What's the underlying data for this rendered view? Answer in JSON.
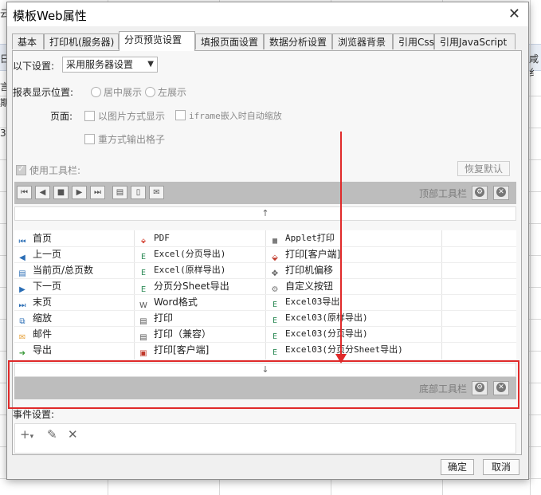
{
  "background": {
    "fragments": [
      "云",
      "日",
      "言",
      "期",
      "34",
      "咸纟"
    ]
  },
  "dialog": {
    "title": "模板Web属性",
    "close_glyph": "✕"
  },
  "tabs": [
    {
      "label": "基本"
    },
    {
      "label": "打印机(服务器)"
    },
    {
      "label": "分页预览设置"
    },
    {
      "label": "填报页面设置"
    },
    {
      "label": "数据分析设置"
    },
    {
      "label": "浏览器背景"
    },
    {
      "label": "引用Css"
    },
    {
      "label": "引用JavaScript"
    }
  ],
  "active_tab": "分页预览设置",
  "settings": {
    "label": "以下设置:",
    "selected": "采用服务器设置",
    "report_position_label": "报表显示位置:",
    "radio_center": "居中展示",
    "radio_left": "左展示",
    "page_label": "页面:",
    "check_image": "以图片方式显示",
    "check_iframe": "iframe嵌入时自动缩放",
    "check_reprint": "重方式输出格子",
    "use_toolbar": "使用工具栏:",
    "restore_default": "恢复默认"
  },
  "top_toolbar": {
    "label": "顶部工具栏",
    "buttons": [
      "first",
      "prev",
      "stop",
      "next",
      "last",
      "print",
      "export",
      "mail"
    ]
  },
  "bottom_toolbar": {
    "label": "底部工具栏"
  },
  "arrows": {
    "up": "↑",
    "down": "↓"
  },
  "grid": {
    "col1": [
      "首页",
      "上一页",
      "当前页/总页数",
      "下一页",
      "末页",
      "缩放",
      "邮件",
      "导出"
    ],
    "col2": [
      "PDF",
      "Excel(分页导出)",
      "Excel(原样导出)",
      "分页分Sheet导出",
      "Word格式",
      "打印",
      "打印（兼容）",
      "打印[客户端]"
    ],
    "col3": [
      "Applet打印",
      "打印[客户端]",
      "打印机偏移",
      "自定义按钮",
      "Excel03导出",
      "Excel03(原样导出)",
      "Excel03(分页导出)",
      "Excel03(分页分Sheet导出)"
    ]
  },
  "events": {
    "label": "事件设置:"
  },
  "footer": {
    "ok": "确定",
    "cancel": "取消"
  }
}
